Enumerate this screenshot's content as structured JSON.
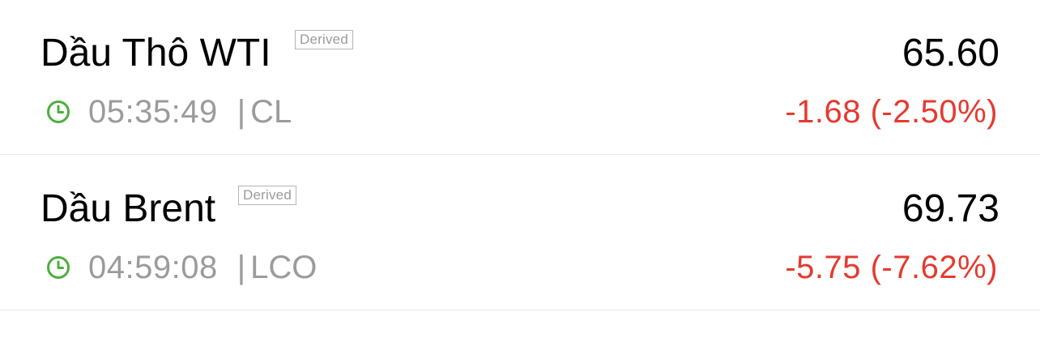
{
  "quotes": [
    {
      "name": "Dầu Thô WTI",
      "badge": "Derived",
      "time": "05:35:49",
      "separator": "|",
      "code": "CL",
      "price": "65.60",
      "change": "-1.68 (-2.50%)",
      "status_icon": "clock-icon"
    },
    {
      "name": "Dầu Brent",
      "badge": "Derived",
      "time": "04:59:08",
      "separator": "|",
      "code": "LCO",
      "price": "69.73",
      "change": "-5.75 (-7.62%)",
      "status_icon": "clock-icon"
    }
  ],
  "colors": {
    "negative": "#e53a2f",
    "clock": "#4caf3c",
    "muted": "#9b9b9b",
    "divider": "#e9e9e9"
  }
}
